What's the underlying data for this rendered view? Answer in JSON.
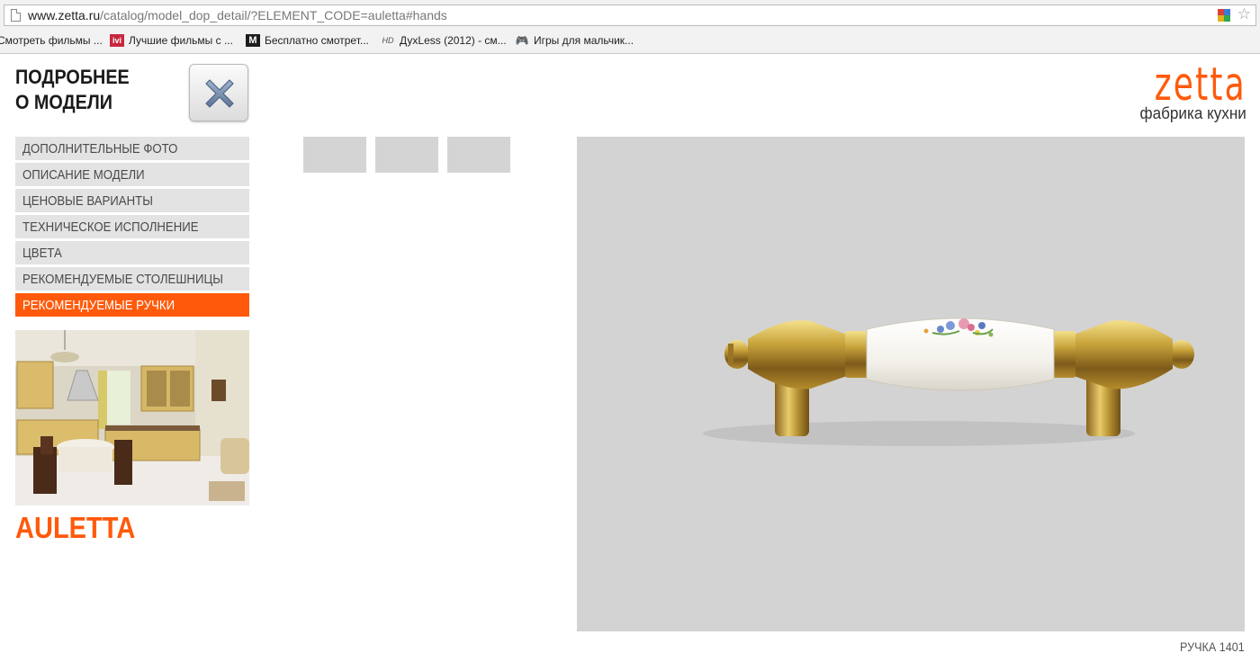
{
  "browser": {
    "url_host": "www.zetta.ru",
    "url_path": "/catalog/model_dop_detail/?ELEMENT_CODE=auletta#hands",
    "bookmarks": [
      {
        "label": "Смотреть фильмы ...",
        "icon": "film-icon"
      },
      {
        "label": "Лучшие фильмы с ...",
        "icon": "ivi-icon",
        "icon_text": "ivi"
      },
      {
        "label": "Бесплатно смотрет...",
        "icon": "m-icon",
        "icon_text": "M"
      },
      {
        "label": "ДухLess (2012) - см...",
        "icon": "hd-icon",
        "icon_text": "HD"
      },
      {
        "label": "Игры для мальчик...",
        "icon": "gamepad-icon"
      }
    ]
  },
  "sidebar": {
    "heading_line1": "ПОДРОБНЕЕ",
    "heading_line2": "О МОДЕЛИ",
    "menu": [
      {
        "label": "ДОПОЛНИТЕЛЬНЫЕ ФОТО",
        "active": false
      },
      {
        "label": "ОПИСАНИЕ МОДЕЛИ",
        "active": false
      },
      {
        "label": "ЦЕНОВЫЕ ВАРИАНТЫ",
        "active": false
      },
      {
        "label": "ТЕХНИЧЕСКОЕ ИСПОЛНЕНИЕ",
        "active": false
      },
      {
        "label": "ЦВЕТА",
        "active": false
      },
      {
        "label": "РЕКОМЕНДУЕМЫЕ СТОЛЕШНИЦЫ",
        "active": false
      },
      {
        "label": "РЕКОМЕНДУЕМЫЕ РУЧКИ",
        "active": true
      }
    ],
    "model_name": "AULETTA"
  },
  "logo": {
    "word": "zetta",
    "subtitle": "фабрика кухни"
  },
  "viewer": {
    "caption": "РУЧКА 1401"
  },
  "colors": {
    "accent": "#ff5a0b",
    "menu_bg": "#e3e3e3",
    "viewer_bg": "#d3d3d3"
  }
}
